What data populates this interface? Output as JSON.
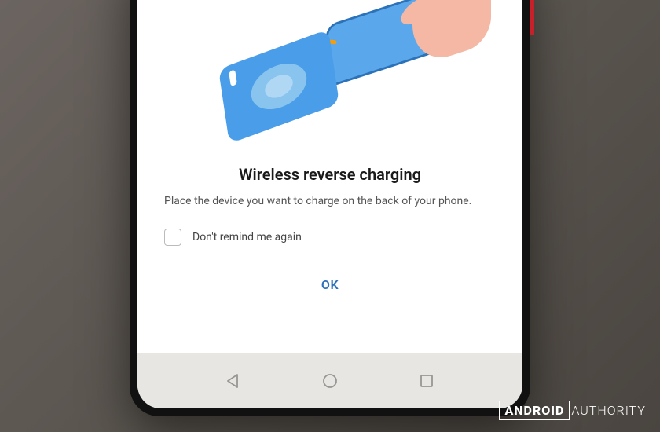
{
  "dialog": {
    "title": "Wireless reverse charging",
    "body": "Place the device you want to charge on the back of your phone.",
    "checkbox_label": "Don't remind me again",
    "ok_label": "OK"
  },
  "watermark": {
    "brand_bold": "ANDROID",
    "brand_light": "AUTHORITY"
  },
  "colors": {
    "accent": "#2c72b8",
    "illustration_phone": "#4a9de8",
    "arrow": "#f59e0b",
    "hand": "#f4b8a5"
  }
}
